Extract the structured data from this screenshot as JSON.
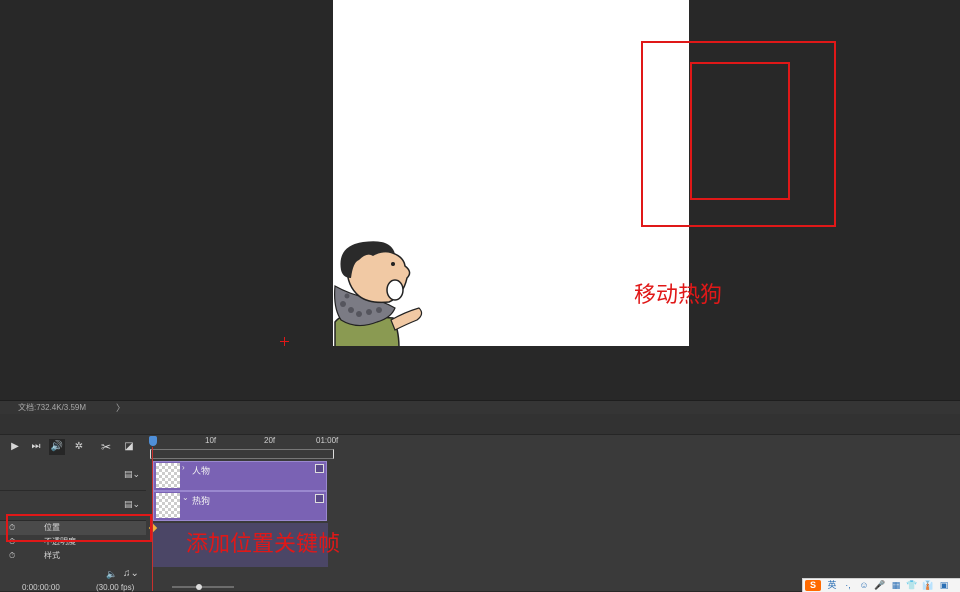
{
  "status": {
    "doc_info": "文档:732.4K/3.59M",
    "arrow": "〉"
  },
  "annotations": {
    "move_hotdog": "移动热狗",
    "add_keyframe": "添加位置关键帧",
    "color": "#e01818"
  },
  "timeline": {
    "ruler_ticks": [
      "10f",
      "20f",
      "01:00f"
    ],
    "layers": [
      {
        "name": "人物",
        "chevron": "›"
      },
      {
        "name": "热狗",
        "chevron": "⌄"
      }
    ],
    "properties": [
      "位置",
      "不透明度",
      "样式"
    ],
    "time_code": "0:00:00:00",
    "fps": "(30.00 fps)",
    "clip_color": "#7a62b4",
    "playhead_color": "#c8302e"
  },
  "ime": {
    "logo": "S",
    "items": [
      "英",
      "·,",
      "☺",
      "🎤",
      "▦",
      "👕",
      "👔",
      "▣"
    ]
  }
}
